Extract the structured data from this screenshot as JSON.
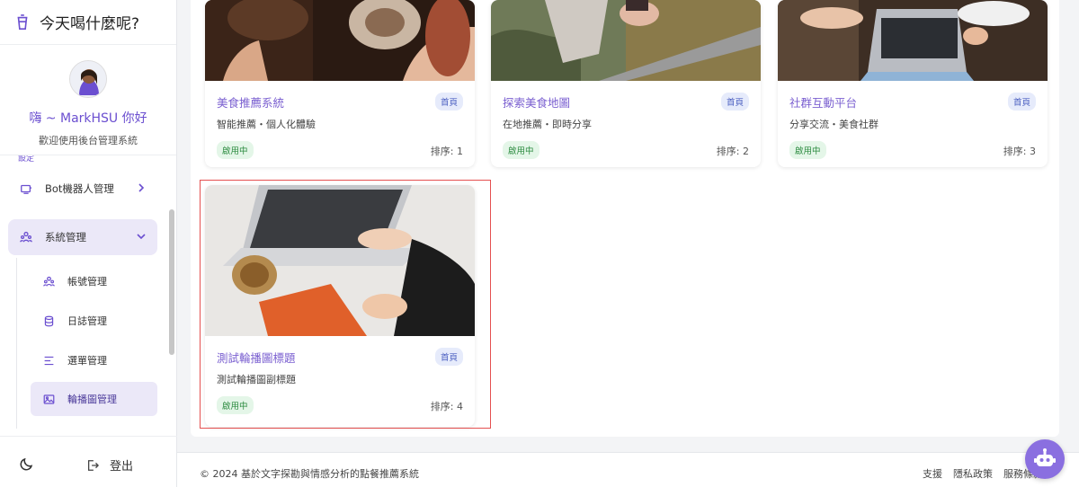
{
  "app": {
    "title": "今天喝什麼呢?"
  },
  "profile": {
    "greeting": "嗨 ~ MarkHSU 你好",
    "welcome": "歡迎使用後台管理系統"
  },
  "sidebar": {
    "partial_label": "設定",
    "items": [
      {
        "label": "Bot機器人管理",
        "icon": "robot-icon"
      },
      {
        "label": "系統管理",
        "icon": "users-icon",
        "expanded": true
      }
    ],
    "subitems": [
      {
        "label": "帳號管理",
        "icon": "users-icon"
      },
      {
        "label": "日誌管理",
        "icon": "database-icon"
      },
      {
        "label": "選單管理",
        "icon": "menu-icon"
      },
      {
        "label": "輪播圖管理",
        "icon": "image-icon",
        "current": true
      }
    ],
    "logout_label": "登出"
  },
  "cards": [
    {
      "title": "美食推薦系統",
      "tag": "首頁",
      "subtitle": "智能推薦・個人化體驗",
      "status": "啟用中",
      "order": "排序: 1"
    },
    {
      "title": "探索美食地圖",
      "tag": "首頁",
      "subtitle": "在地推薦・即時分享",
      "status": "啟用中",
      "order": "排序: 2"
    },
    {
      "title": "社群互動平台",
      "tag": "首頁",
      "subtitle": "分享交流・美食社群",
      "status": "啟用中",
      "order": "排序: 3"
    },
    {
      "title": "測試輪播圖標題",
      "tag": "首頁",
      "subtitle": "測試輪播圖副標題",
      "status": "啟用中",
      "order": "排序: 4"
    }
  ],
  "footer": {
    "copyright": "© 2024 基於文字探勘與情感分析的點餐推薦系統",
    "links": [
      "支援",
      "隱私政策",
      "服務條款"
    ]
  },
  "colors": {
    "accent": "#6b4fd0",
    "status_green": "#2a8a3e",
    "tag_blue": "#4b5fc0",
    "highlight": "#e45050"
  }
}
